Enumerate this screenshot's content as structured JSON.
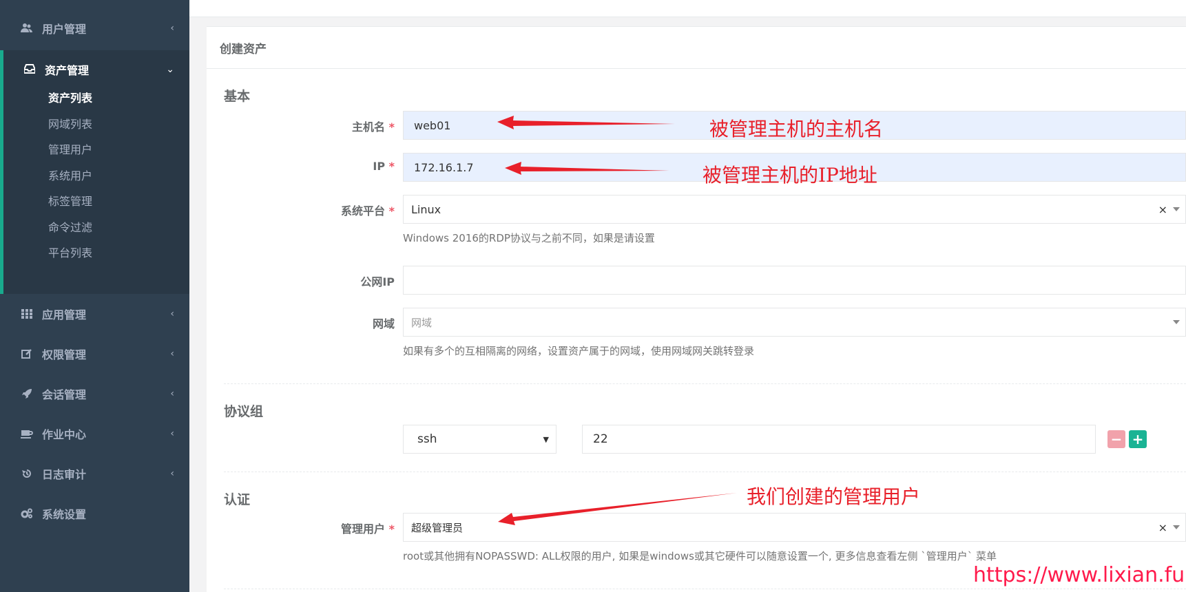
{
  "sidebar": {
    "items": [
      {
        "label": "用户管理",
        "icon": "users-icon"
      },
      {
        "label": "资产管理",
        "icon": "inbox-icon"
      },
      {
        "label": "应用管理",
        "icon": "grid-icon"
      },
      {
        "label": "权限管理",
        "icon": "edit-icon"
      },
      {
        "label": "会话管理",
        "icon": "rocket-icon"
      },
      {
        "label": "作业中心",
        "icon": "coffee-icon"
      },
      {
        "label": "日志审计",
        "icon": "history-icon"
      },
      {
        "label": "系统设置",
        "icon": "gears-icon"
      }
    ],
    "subitems": [
      "资产列表",
      "网域列表",
      "管理用户",
      "系统用户",
      "标签管理",
      "命令过滤",
      "平台列表"
    ]
  },
  "panel": {
    "title": "创建资产",
    "section_basic": "基本",
    "section_protocol": "协议组",
    "section_auth": "认证"
  },
  "form": {
    "hostname_label": "主机名",
    "hostname_value": "web01",
    "ip_label": "IP",
    "ip_value": "172.16.1.7",
    "platform_label": "系统平台",
    "platform_value": "Linux",
    "platform_help": "Windows 2016的RDP协议与之前不同，如果是请设置",
    "public_ip_label": "公网IP",
    "public_ip_value": "",
    "domain_label": "网域",
    "domain_placeholder": "网域",
    "domain_help": "如果有多个的互相隔离的网络，设置资产属于的网域，使用网域网关跳转登录",
    "protocol_value": "ssh",
    "port_value": "22",
    "admin_user_label": "管理用户",
    "admin_user_value": "超级管理员",
    "admin_user_help": "root或其他拥有NOPASSWD: ALL权限的用户, 如果是windows或其它硬件可以随意设置一个, 更多信息查看左侧 `管理用户` 菜单",
    "required_mark": "*",
    "clear_glyph": "×",
    "minus_glyph": "−",
    "plus_glyph": "+"
  },
  "annotations": {
    "hostname_note": "被管理主机的主机名",
    "ip_note": "被管理主机的IP地址",
    "admin_note": "我们创建的管理用户",
    "watermark": "https://www.lixian.fun",
    "color": "#e8202a"
  },
  "colors": {
    "sidebar_bg": "#2f4050",
    "accent": "#19aa8d",
    "required": "#ed5565"
  }
}
